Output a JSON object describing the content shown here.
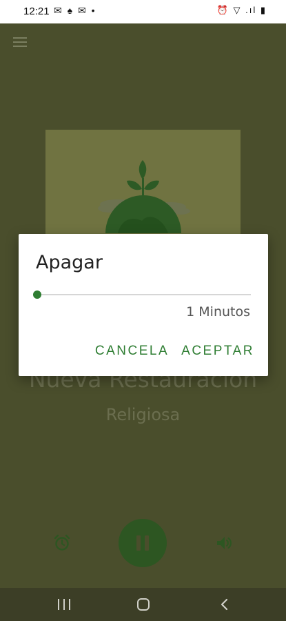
{
  "status_bar": {
    "time": "12:21",
    "notification_icons": "✉ ♠ ✉ •",
    "system_icons": "⏰ ▽ .ıl ▮"
  },
  "app": {
    "menu_icon": "hamburger-menu-icon",
    "station_title": "Nueva Restauración",
    "station_genre": "Religiosa",
    "controls": {
      "alarm_icon": "alarm-clock-icon",
      "play_icon": "pause-icon",
      "volume_icon": "volume-icon"
    },
    "colors": {
      "background": "#4a4e2c",
      "accent": "#2e7d32",
      "play_button": "#2d5622"
    }
  },
  "dialog": {
    "title": "Apagar",
    "slider_value_label": "1 Minutos",
    "slider_level": 0,
    "cancel_label": "CANCELA",
    "accept_label": "ACEPTAR"
  },
  "nav_bar": {
    "recent_icon": "recent-apps-icon",
    "home_icon": "home-icon",
    "back_icon": "back-icon"
  }
}
